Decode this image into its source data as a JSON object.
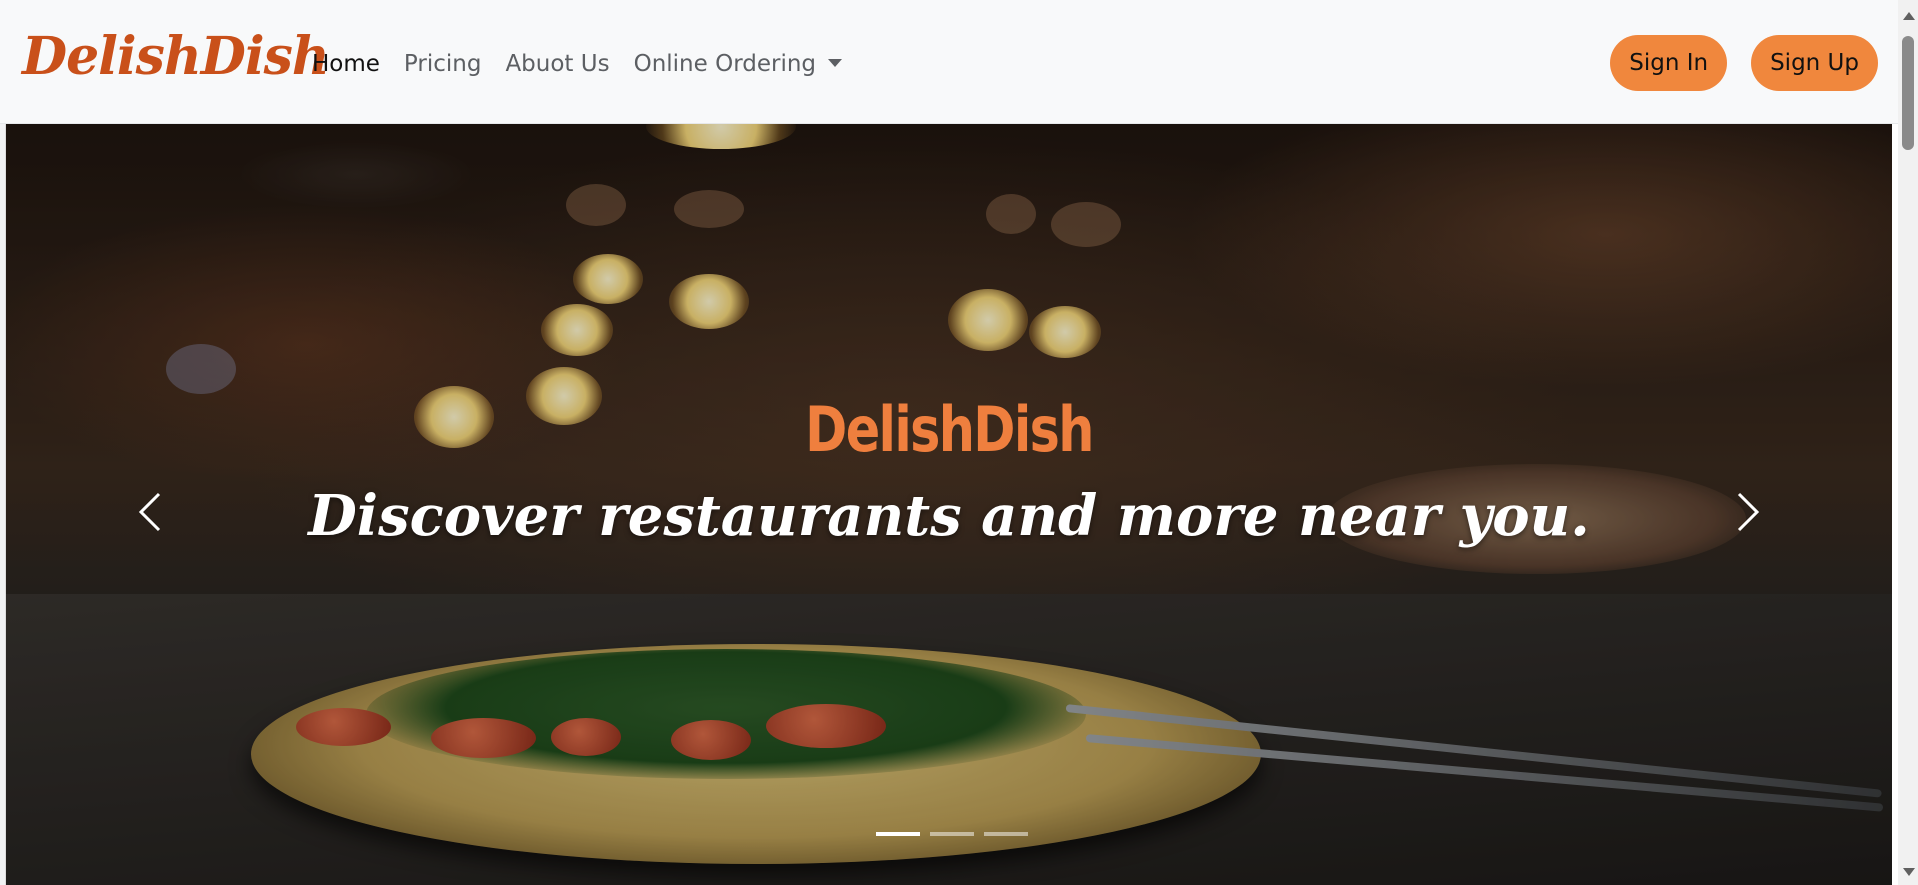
{
  "brand": {
    "name": "DelishDish",
    "color": "#c9501a"
  },
  "nav": {
    "links": [
      {
        "label": "Home",
        "active": true
      },
      {
        "label": "Pricing",
        "active": false
      },
      {
        "label": "Abuot Us",
        "active": false
      },
      {
        "label": "Online Ordering",
        "active": false,
        "dropdown": true
      }
    ]
  },
  "auth": {
    "sign_in": "Sign In",
    "sign_up": "Sign Up",
    "button_color": "#f0873d"
  },
  "hero": {
    "title": "DelishDish",
    "tagline": "Discover restaurants and more near you.",
    "title_color": "#ef7f3e",
    "prev_icon": "chevron-left-icon",
    "next_icon": "chevron-right-icon",
    "slides_total": 3,
    "active_slide": 1
  }
}
